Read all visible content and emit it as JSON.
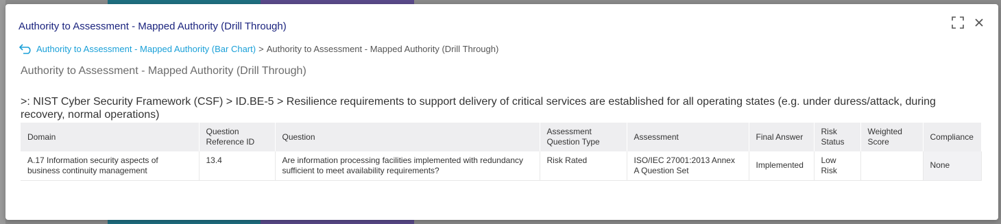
{
  "modal": {
    "title": "Authority to Assessment - Mapped Authority (Drill Through)"
  },
  "icons": {
    "expand": "expand-icon",
    "close": "close-icon",
    "back": "back-arrow-icon"
  },
  "breadcrumb": {
    "parent_label": "Authority to Assessment - Mapped Authority (Bar Chart)",
    "separator": ">",
    "current_label": "Authority to Assessment - Mapped Authority (Drill Through)"
  },
  "report": {
    "title": "Authority to Assessment - Mapped Authority (Drill Through)",
    "filter_path": ">: NIST Cyber Security Framework (CSF) > ID.BE-5 > Resilience requirements to support delivery of critical services are established for all operating states (e.g. under duress/attack, during recovery, normal operations)"
  },
  "table": {
    "headers": {
      "domain": "Domain",
      "question_ref_id": "Question Reference ID",
      "question": "Question",
      "assessment_question_type": "Assessment Question Type",
      "assessment": "Assessment",
      "final_answer": "Final Answer",
      "risk_status": "Risk Status",
      "weighted_score": "Weighted Score",
      "compliance": "Compliance"
    },
    "rows": [
      {
        "domain": "A.17 Information security aspects of business continuity management",
        "question_ref_id": "13.4",
        "question": "Are information processing facilities implemented with redundancy sufficient to meet availability requirements?",
        "assessment_question_type": "Risk Rated",
        "assessment": "ISO/IEC 27001:2013 Annex A Question Set",
        "final_answer": "Implemented",
        "risk_status": "Low Risk",
        "weighted_score": "",
        "compliance": "None"
      }
    ]
  },
  "colors": {
    "title": "#1a237e",
    "link": "#1aa0d8",
    "header_bg": "#eeeef0"
  }
}
